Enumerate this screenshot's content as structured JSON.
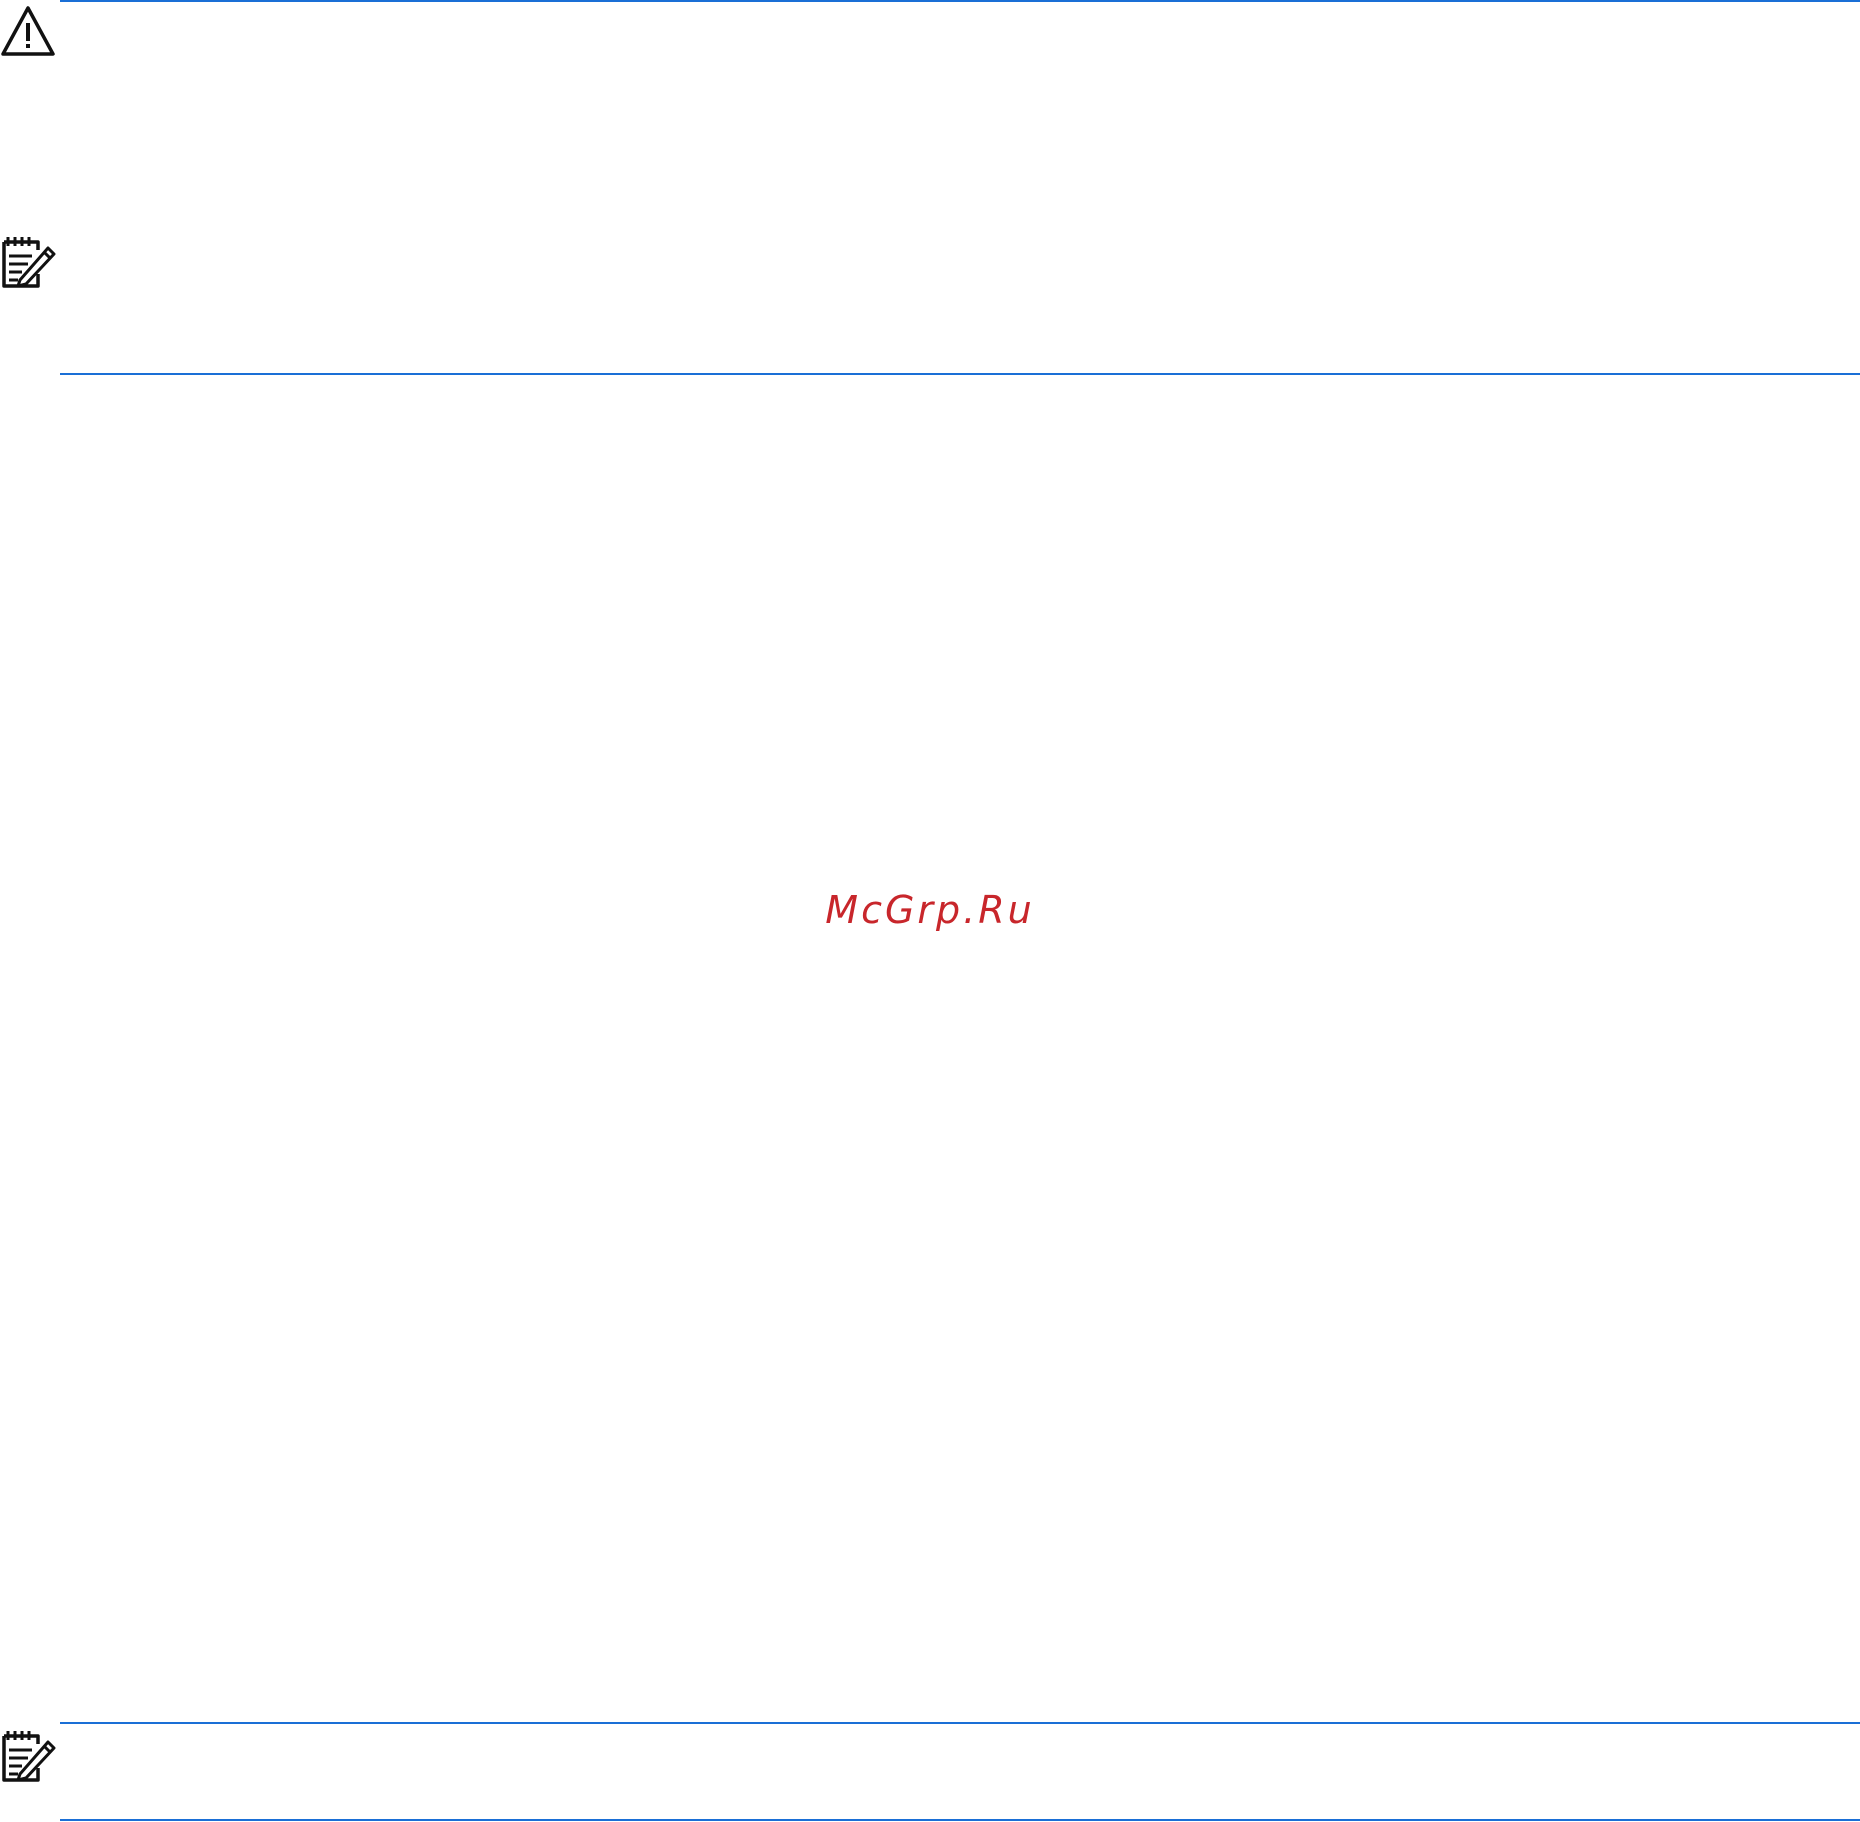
{
  "watermark": {
    "text": "McGrp.Ru"
  },
  "colors": {
    "rule": "#1a6fd6",
    "watermark": "#c8262b",
    "icon": "#111111"
  },
  "icons": [
    "warning-icon",
    "note-icon",
    "note-icon"
  ]
}
